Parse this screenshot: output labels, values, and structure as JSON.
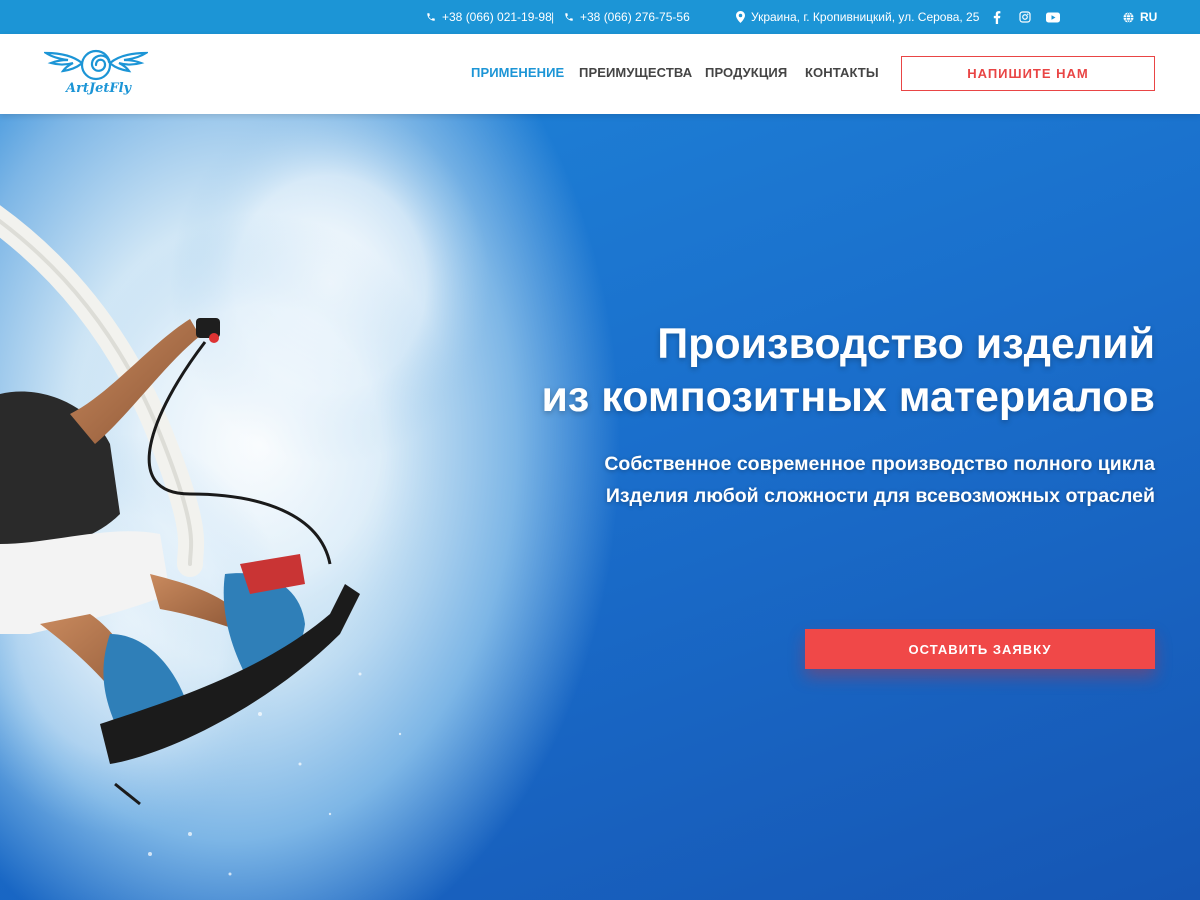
{
  "topbar": {
    "phone1": "+38 (066) 021-19-98",
    "separator": "|",
    "phone2": "+38 (066) 276-75-56",
    "address": "Украина, г. Кропивницкий, ул. Серова, 25",
    "social": [
      "facebook-icon",
      "instagram-icon",
      "youtube-icon"
    ],
    "language": "RU"
  },
  "header": {
    "logo_text": "ArtJetFly",
    "nav": [
      "ПРИМЕНЕНИЕ",
      "ПРЕИМУЩЕСТВА",
      "ПРОДУКЦИЯ",
      "КОНТАКТЫ"
    ],
    "active_nav": "ПРИМЕНЕНИЕ",
    "write_button": "НАПИШИТЕ НАМ"
  },
  "hero": {
    "title_line1": "Производство изделий",
    "title_line2": "из композитных материалов",
    "subtitle_line1": "Собственное современное производство полного цикла",
    "subtitle_line2": "Изделия любой сложности для всевозможных отраслей",
    "cta": "ОСТАВИТЬ ЗАЯВКУ"
  },
  "colors": {
    "topbar": "#1c95d6",
    "accent": "#1c95d6",
    "cta": "#f04848"
  }
}
